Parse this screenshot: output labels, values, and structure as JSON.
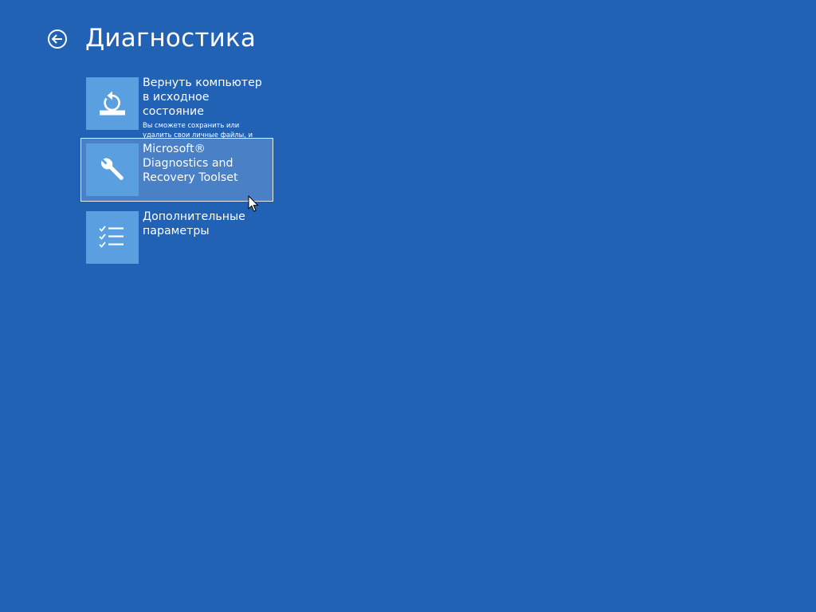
{
  "page": {
    "title": "Диагностика",
    "background": "#2262b4"
  },
  "back": {
    "icon": "back-arrow-icon"
  },
  "tiles": [
    {
      "id": "reset",
      "icon": "reset-pc-icon",
      "title": "Вернуть компьютер в исходное состояние",
      "description": "Вы сможете сохранить или удалить свои личные файлы, и затем переустановить Windows.",
      "selected": false
    },
    {
      "id": "dart",
      "icon": "wrench-icon",
      "title": "Microsoft® Diagnostics and Recovery Toolset",
      "description": "",
      "selected": true
    },
    {
      "id": "advanced",
      "icon": "checklist-icon",
      "title": "Дополнительные параметры",
      "description": "",
      "selected": false
    }
  ],
  "colors": {
    "tile_icon_bg": "#5aa0e0",
    "selected_bg": "#4a80c6",
    "selected_border": "#e8eef8"
  }
}
